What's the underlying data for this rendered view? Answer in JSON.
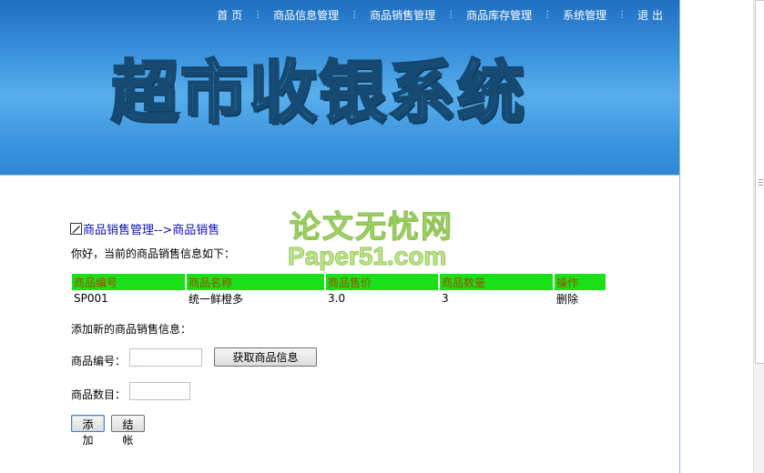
{
  "nav": {
    "items": [
      "首 页",
      "商品信息管理",
      "商品销售管理",
      "商品库存管理",
      "系统管理",
      "退 出"
    ]
  },
  "banner": {
    "title": "超市收银系统"
  },
  "watermark": {
    "line1": "论文无忧网",
    "line2": "Paper51.com"
  },
  "breadcrumb": {
    "text": "商品销售管理-->商品销售"
  },
  "greeting": "你好，当前的商品销售信息如下：",
  "table": {
    "headers": [
      "商品编号",
      "商品名称",
      "商品售价",
      "商品数量",
      "操作"
    ],
    "rows": [
      [
        "SP001",
        "统一鲜橙多",
        "3.0",
        "3",
        "删除"
      ]
    ]
  },
  "add_form": {
    "title": "添加新的商品销售信息：",
    "code_label": "商品编号：",
    "code_value": "",
    "fetch_button": "获取商品信息",
    "qty_label": "商品数目：",
    "qty_value": "",
    "add_button": "添加",
    "checkout_button": "结帐"
  },
  "colors": {
    "header_green": "#19e019",
    "header_text": "#a34a00",
    "banner_blue": "#3f97e0",
    "link_blue": "#1010c0"
  }
}
